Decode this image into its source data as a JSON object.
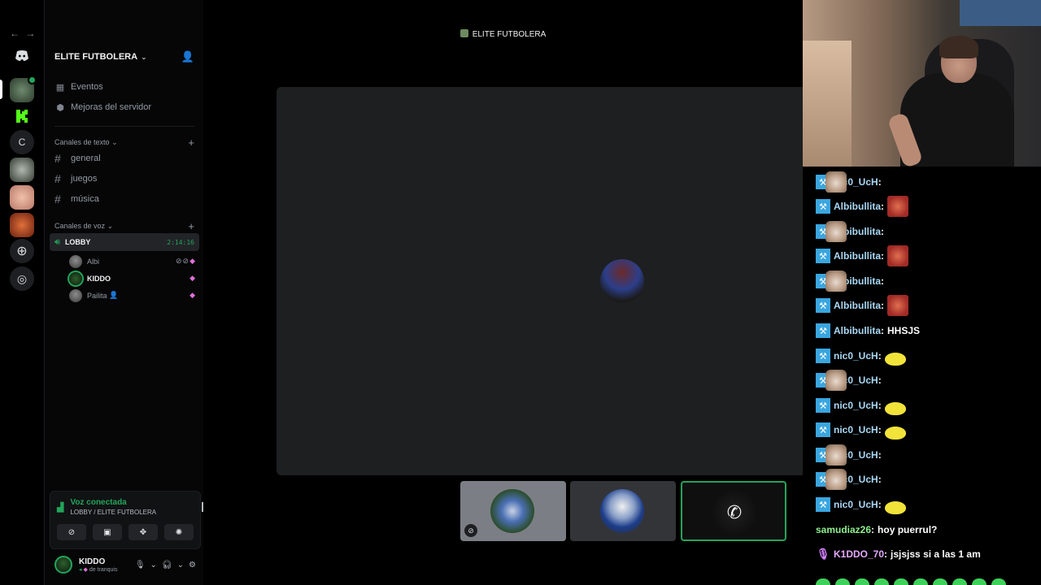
{
  "rail": {
    "back_arrow": "←",
    "forward_arrow": "→",
    "letter_server": "C"
  },
  "server": {
    "name": "ELITE FUTBOLERA",
    "nav": [
      {
        "icon": "calendar-icon",
        "label": "Eventos"
      },
      {
        "icon": "boost-icon",
        "label": "Mejoras del servidor"
      }
    ],
    "text_category": "Canales de texto",
    "text_channels": [
      "general",
      "juegos",
      "música"
    ],
    "voice_category": "Canales de voz",
    "voice_channel": {
      "name": "LOBBY",
      "timer": "2:14:16"
    },
    "voice_users": [
      {
        "name": "Albi"
      },
      {
        "name": "KIDDO"
      },
      {
        "name": "Pailita"
      }
    ]
  },
  "voice_panel": {
    "title": "Voz conectada",
    "subtitle": "LOBBY / ELITE FUTBOLERA"
  },
  "user": {
    "name": "KIDDO",
    "status": "de tranquis"
  },
  "call": {
    "title": "ELITE FUTBOLERA"
  },
  "chat": {
    "messages": [
      {
        "user": "nic0_UcH",
        "emotes": [
          "cat",
          "cat",
          "cat",
          "cat",
          "cat"
        ],
        "text": ""
      },
      {
        "user": "Albibullita",
        "emotes": [
          "face"
        ],
        "text": ""
      },
      {
        "user": "Albibullita",
        "emotes": [
          "cat"
        ],
        "text": ""
      },
      {
        "user": "Albibullita",
        "emotes": [
          "face"
        ],
        "text": ""
      },
      {
        "user": "Albibullita",
        "emotes": [
          "cat"
        ],
        "text": ""
      },
      {
        "user": "Albibullita",
        "emotes": [
          "face"
        ],
        "text": ""
      },
      {
        "user": "Albibullita",
        "emotes": [],
        "text": "HHSJS"
      },
      {
        "user": "nic0_UcH",
        "emotes": [
          "duck"
        ],
        "text": ""
      },
      {
        "user": "nic0_UcH",
        "emotes": [
          "cat"
        ],
        "text": ""
      },
      {
        "user": "nic0_UcH",
        "emotes": [
          "duck"
        ],
        "text": ""
      },
      {
        "user": "nic0_UcH",
        "emotes": [
          "duck"
        ],
        "text": ""
      },
      {
        "user": "nic0_UcH",
        "emotes": [
          "cat"
        ],
        "text": ""
      },
      {
        "user": "nic0_UcH",
        "emotes": [
          "cat"
        ],
        "text": ""
      },
      {
        "user": "nic0_UcH",
        "emotes": [
          "duck"
        ],
        "text": ""
      },
      {
        "user": "samudiaz26",
        "emotes": [],
        "text": "hoy puerrul?"
      },
      {
        "user": "K1DDO_70",
        "emotes": [],
        "text": "jsjsjss si a las 1 am"
      }
    ]
  },
  "colors": {
    "accent_green": "#23a55a",
    "nitro_pink": "#e070d8",
    "chat_badge": "#3aa6e0"
  }
}
